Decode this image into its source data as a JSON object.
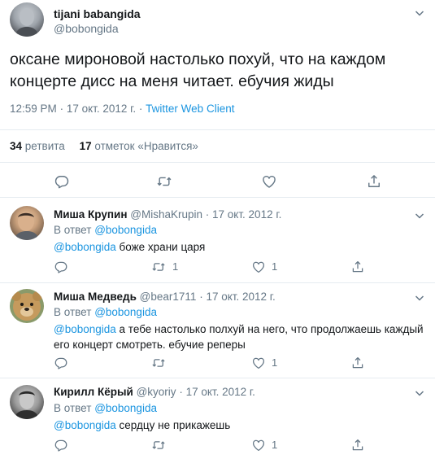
{
  "main_tweet": {
    "author_name": "tijani babangida",
    "author_handle": "@bobongida",
    "text_line1": "оксане мироновой настолько похуй, что на каждом",
    "text_line2": "концерте дисс на меня читает. ебучия жиды",
    "time": "12:59 PM",
    "date": "17 окт. 2012 г.",
    "separator": "·",
    "client": "Twitter Web Client",
    "retweets_count": "34",
    "retweets_label": "ретвита",
    "likes_count": "17",
    "likes_label": "отметок «Нравится»"
  },
  "replies": [
    {
      "author_name": "Миша Крупин",
      "author_handle": "@MishaKrupin",
      "separator": "·",
      "date": "17 окт. 2012 г.",
      "reply_prefix": "В ответ",
      "reply_to": "@bobongida",
      "mention": "@bobongida",
      "text": "боже храни царя",
      "retweets": "1",
      "likes": "1"
    },
    {
      "author_name": "Миша Медведь",
      "author_handle": "@bear1711",
      "separator": "·",
      "date": "17 окт. 2012 г.",
      "reply_prefix": "В ответ",
      "reply_to": "@bobongida",
      "mention": "@bobongida",
      "text_line1": "а тебе настолько полхуй на него, что продолжаешь каждый",
      "text_line2": "его концерт смотреть. ебучие реперы",
      "likes": "1"
    },
    {
      "author_name": "Кирилл Кёрый",
      "author_handle": "@kyoriy",
      "separator": "·",
      "date": "17 окт. 2012 г.",
      "reply_prefix": "В ответ",
      "reply_to": "@bobongida",
      "mention": "@bobongida",
      "text": "сердцу не прикажешь",
      "likes": "1"
    }
  ],
  "colors": {
    "link": "#1b95e0",
    "muted": "#657786",
    "text": "#14171a",
    "divider": "#e6ecf0"
  }
}
